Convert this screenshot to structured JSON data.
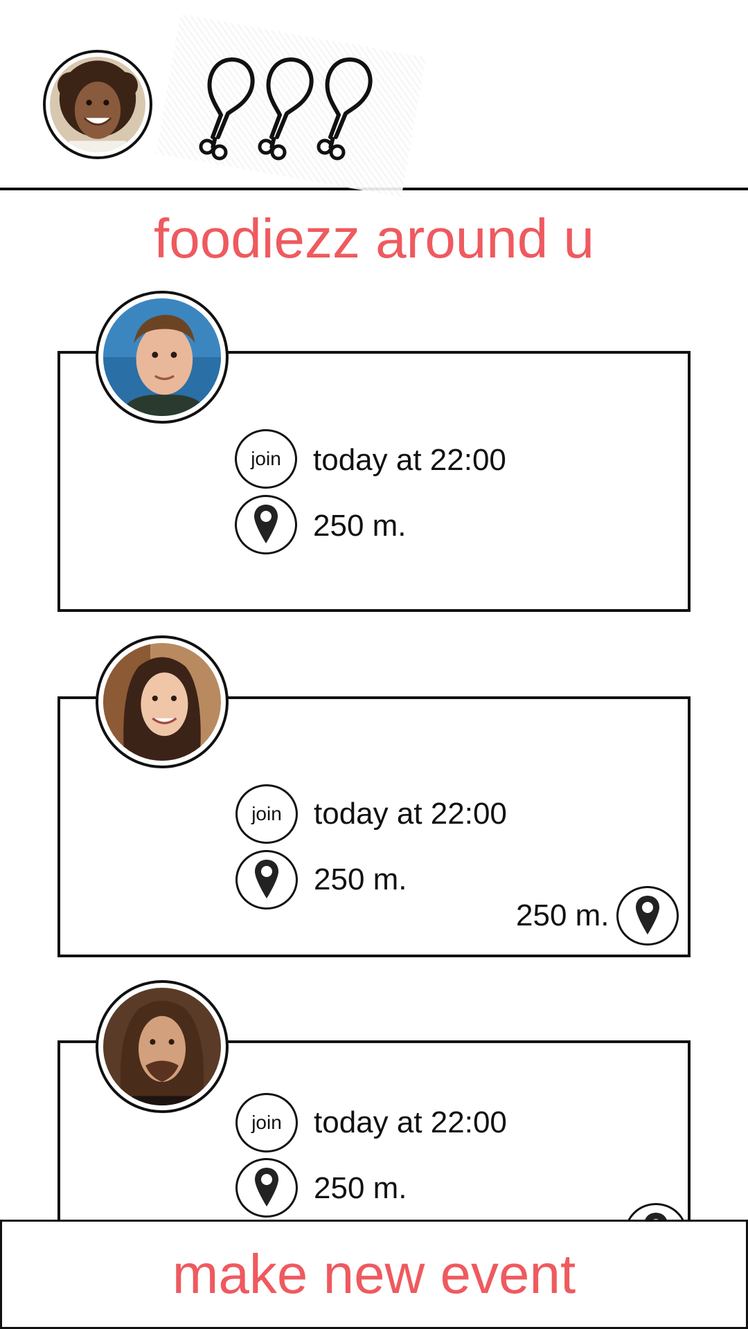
{
  "header": {
    "avatar_icon": "user-avatar",
    "rating_icon": "drumstick-icon",
    "rating_count": 3
  },
  "title": "foodiezz around u",
  "events": [
    {
      "join_label": "join",
      "time": "today at 22:00",
      "distance": "250 m.",
      "extra_distance": ""
    },
    {
      "join_label": "join",
      "time": "today at 22:00",
      "distance": "250 m.",
      "extra_distance": "250 m."
    },
    {
      "join_label": "join",
      "time": "today at 22:00",
      "distance": "250 m.",
      "extra_distance": ""
    }
  ],
  "footer": {
    "action_label": "make new event"
  },
  "colors": {
    "accent": "#ee5a5f",
    "ink": "#111111",
    "background": "#ffffff"
  }
}
